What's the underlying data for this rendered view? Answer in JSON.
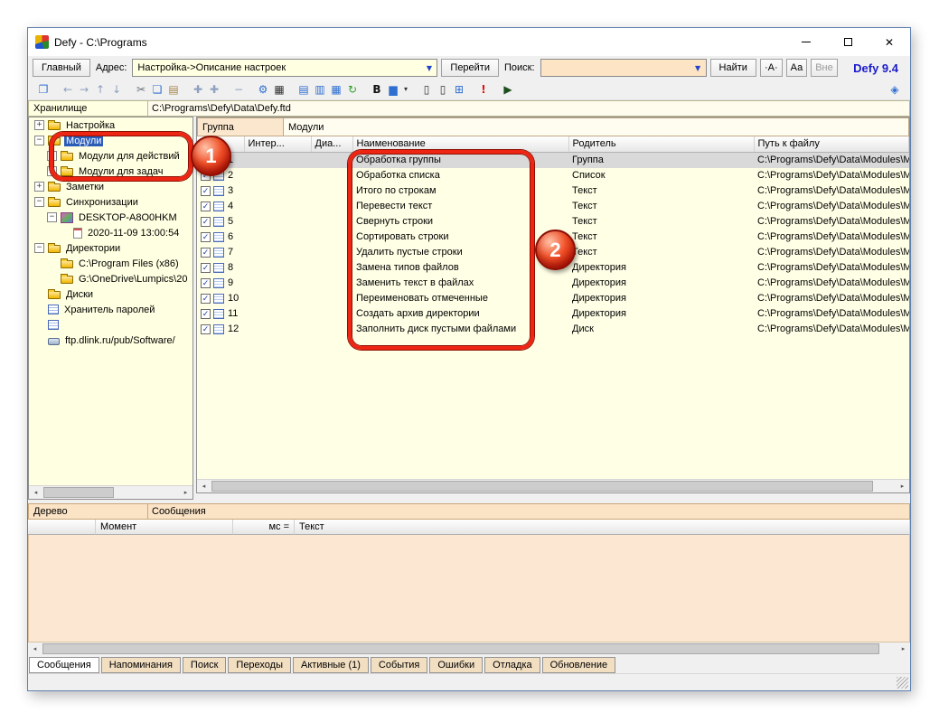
{
  "window": {
    "title": "Defy - C:\\Programs",
    "brand": "Defy 9.4"
  },
  "menubar": {
    "main_button": "Главный",
    "address_label": "Адрес:",
    "address_value": "Настройка->Описание настроек",
    "go_button": "Перейти",
    "search_label": "Поиск:",
    "search_value": "",
    "find_button": "Найти",
    "case_exact": "·А·",
    "case_aa": "Аа",
    "case_out": "Вне"
  },
  "toolbar": {
    "icons": [
      {
        "name": "new-copy-icon",
        "glyph": "❐"
      },
      {
        "name": "back-icon",
        "glyph": "←"
      },
      {
        "name": "forward-icon",
        "glyph": "→"
      },
      {
        "name": "up-icon",
        "glyph": "↑"
      },
      {
        "name": "down-icon",
        "glyph": "↓"
      },
      {
        "name": "cut-icon",
        "glyph": "✂"
      },
      {
        "name": "copy-icon",
        "glyph": "❏"
      },
      {
        "name": "paste-icon",
        "glyph": "▤"
      },
      {
        "name": "add-icon",
        "glyph": "✚"
      },
      {
        "name": "add-child-icon",
        "glyph": "✚"
      },
      {
        "name": "remove-icon",
        "glyph": "−"
      },
      {
        "name": "settings-gear-icon",
        "glyph": "⚙"
      },
      {
        "name": "keyboard-icon",
        "glyph": "▦"
      },
      {
        "name": "document-icon",
        "glyph": "▤"
      },
      {
        "name": "document-columns-icon",
        "glyph": "▥"
      },
      {
        "name": "document-grid-icon",
        "glyph": "▦"
      },
      {
        "name": "refresh-icon",
        "glyph": "↻"
      },
      {
        "name": "bold-icon",
        "glyph": "B"
      },
      {
        "name": "highlight-color-icon",
        "glyph": "▆"
      },
      {
        "name": "dropdown-arrow-icon",
        "glyph": "▾"
      },
      {
        "name": "slider-icon",
        "glyph": "▯"
      },
      {
        "name": "slider2-icon",
        "glyph": "▯"
      },
      {
        "name": "grid-window-icon",
        "glyph": "⊞"
      },
      {
        "name": "alert-icon",
        "glyph": "!"
      },
      {
        "name": "run-icon",
        "glyph": "▶"
      },
      {
        "name": "layers-icon",
        "glyph": "◈"
      }
    ]
  },
  "storage": {
    "label": "Хранилище",
    "path": "C:\\Programs\\Defy\\Data\\Defy.ftd"
  },
  "tree": {
    "items": [
      {
        "label": "Настройка"
      },
      {
        "label": "Модули"
      },
      {
        "label": "Модули для действий"
      },
      {
        "label": "Модули для задач"
      },
      {
        "label": "Заметки"
      },
      {
        "label": "Синхронизации"
      },
      {
        "label": "DESKTOP-A8O0HKM"
      },
      {
        "label": "2020-11-09 13:00:54"
      },
      {
        "label": "Директории"
      },
      {
        "label": "C:\\Program Files (x86)"
      },
      {
        "label": "G:\\OneDrive\\Lumpics\\20"
      },
      {
        "label": "Диски"
      },
      {
        "label": "Хранитель паролей"
      },
      {
        "label": ""
      },
      {
        "label": "ftp.dlink.ru/pub/Software/"
      }
    ]
  },
  "group_bar": {
    "label": "Группа",
    "value": "Модули"
  },
  "table": {
    "columns": [
      "",
      "Интер...",
      "Диа...",
      "Наименование",
      "Родитель",
      "Путь к файлу"
    ],
    "rows": [
      {
        "num": "1",
        "name": "Обработка группы",
        "parent": "Группа",
        "path": "C:\\Programs\\Defy\\Data\\Modules\\M"
      },
      {
        "num": "2",
        "name": "Обработка списка",
        "parent": "Список",
        "path": "C:\\Programs\\Defy\\Data\\Modules\\M"
      },
      {
        "num": "3",
        "name": "Итого по строкам",
        "parent": "Текст",
        "path": "C:\\Programs\\Defy\\Data\\Modules\\M"
      },
      {
        "num": "4",
        "name": "Перевести текст",
        "parent": "Текст",
        "path": "C:\\Programs\\Defy\\Data\\Modules\\M"
      },
      {
        "num": "5",
        "name": "Свернуть строки",
        "parent": "Текст",
        "path": "C:\\Programs\\Defy\\Data\\Modules\\M"
      },
      {
        "num": "6",
        "name": "Сортировать строки",
        "parent": "Текст",
        "path": "C:\\Programs\\Defy\\Data\\Modules\\M"
      },
      {
        "num": "7",
        "name": "Удалить пустые строки",
        "parent": "Текст",
        "path": "C:\\Programs\\Defy\\Data\\Modules\\M"
      },
      {
        "num": "8",
        "name": "Замена типов файлов",
        "parent": "Директория",
        "path": "C:\\Programs\\Defy\\Data\\Modules\\M"
      },
      {
        "num": "9",
        "name": "Заменить текст в файлах",
        "parent": "Директория",
        "path": "C:\\Programs\\Defy\\Data\\Modules\\M"
      },
      {
        "num": "10",
        "name": "Переименовать отмеченные",
        "parent": "Директория",
        "path": "C:\\Programs\\Defy\\Data\\Modules\\M"
      },
      {
        "num": "11",
        "name": "Создать архив директории",
        "parent": "Директория",
        "path": "C:\\Programs\\Defy\\Data\\Modules\\M"
      },
      {
        "num": "12",
        "name": "Заполнить диск пустыми файлами",
        "parent": "Диск",
        "path": "C:\\Programs\\Defy\\Data\\Modules\\M"
      }
    ]
  },
  "bottom": {
    "tree_tab": "Дерево",
    "panel_title": "Сообщения",
    "columns": [
      "",
      "Момент",
      "мс =",
      "Текст"
    ]
  },
  "bottom_tabs": [
    "Сообщения",
    "Напоминания",
    "Поиск",
    "Переходы",
    "Активные (1)",
    "События",
    "Ошибки",
    "Отладка",
    "Обновление"
  ],
  "annotations": {
    "badge1": "1",
    "badge2": "2"
  }
}
